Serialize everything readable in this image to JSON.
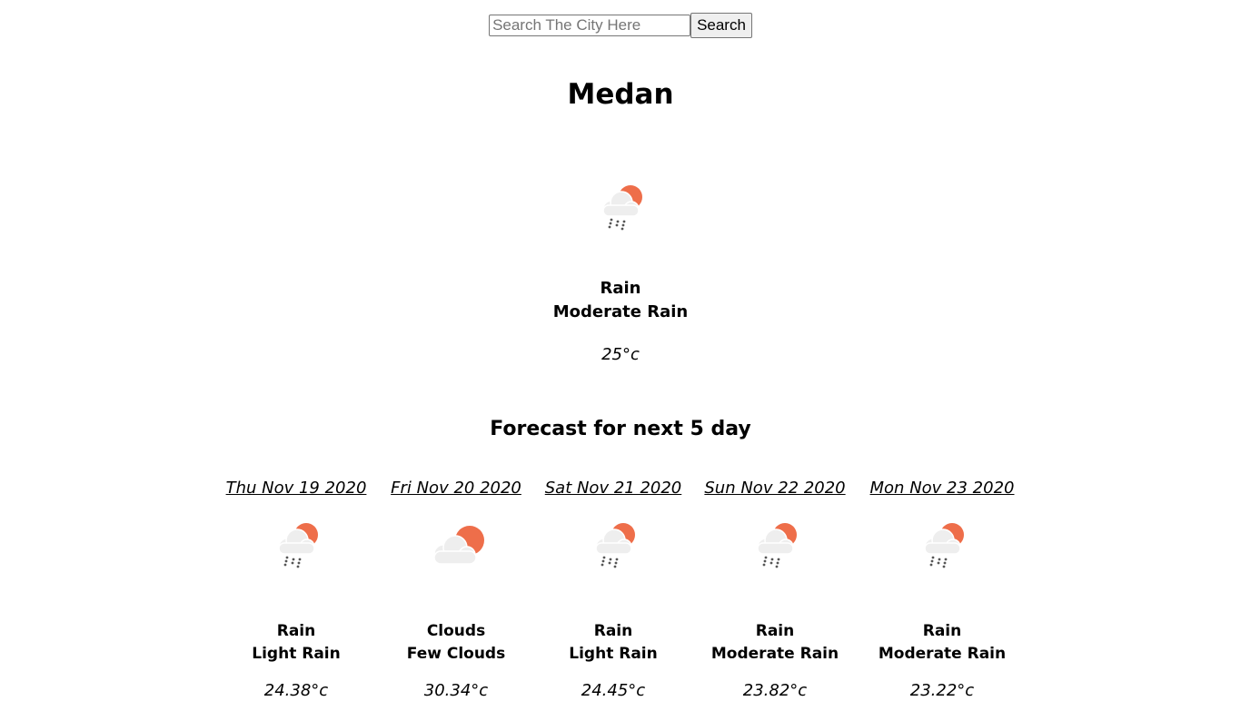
{
  "search": {
    "placeholder": "Search The City Here",
    "value": "",
    "button_label": "Search"
  },
  "city": "Medan",
  "current": {
    "icon": "rain-sun-icon",
    "main": "Rain",
    "description": "Moderate Rain",
    "temperature": "25°c"
  },
  "forecast_title": "Forecast for next 5 day",
  "forecast": [
    {
      "date": "Thu Nov 19 2020",
      "icon": "rain-sun-icon",
      "main": "Rain",
      "description": "Light Rain",
      "temperature": "24.38°c"
    },
    {
      "date": "Fri Nov 20 2020",
      "icon": "clouds-sun-icon",
      "main": "Clouds",
      "description": "Few Clouds",
      "temperature": "30.34°c"
    },
    {
      "date": "Sat Nov 21 2020",
      "icon": "rain-sun-icon",
      "main": "Rain",
      "description": "Light Rain",
      "temperature": "24.45°c"
    },
    {
      "date": "Sun Nov 22 2020",
      "icon": "rain-sun-icon",
      "main": "Rain",
      "description": "Moderate Rain",
      "temperature": "23.82°c"
    },
    {
      "date": "Mon Nov 23 2020",
      "icon": "rain-sun-icon",
      "main": "Rain",
      "description": "Moderate Rain",
      "temperature": "23.22°c"
    }
  ],
  "colors": {
    "sun": "#ee6e4a",
    "cloud": "#f0f0f0",
    "rain": "#555555"
  }
}
